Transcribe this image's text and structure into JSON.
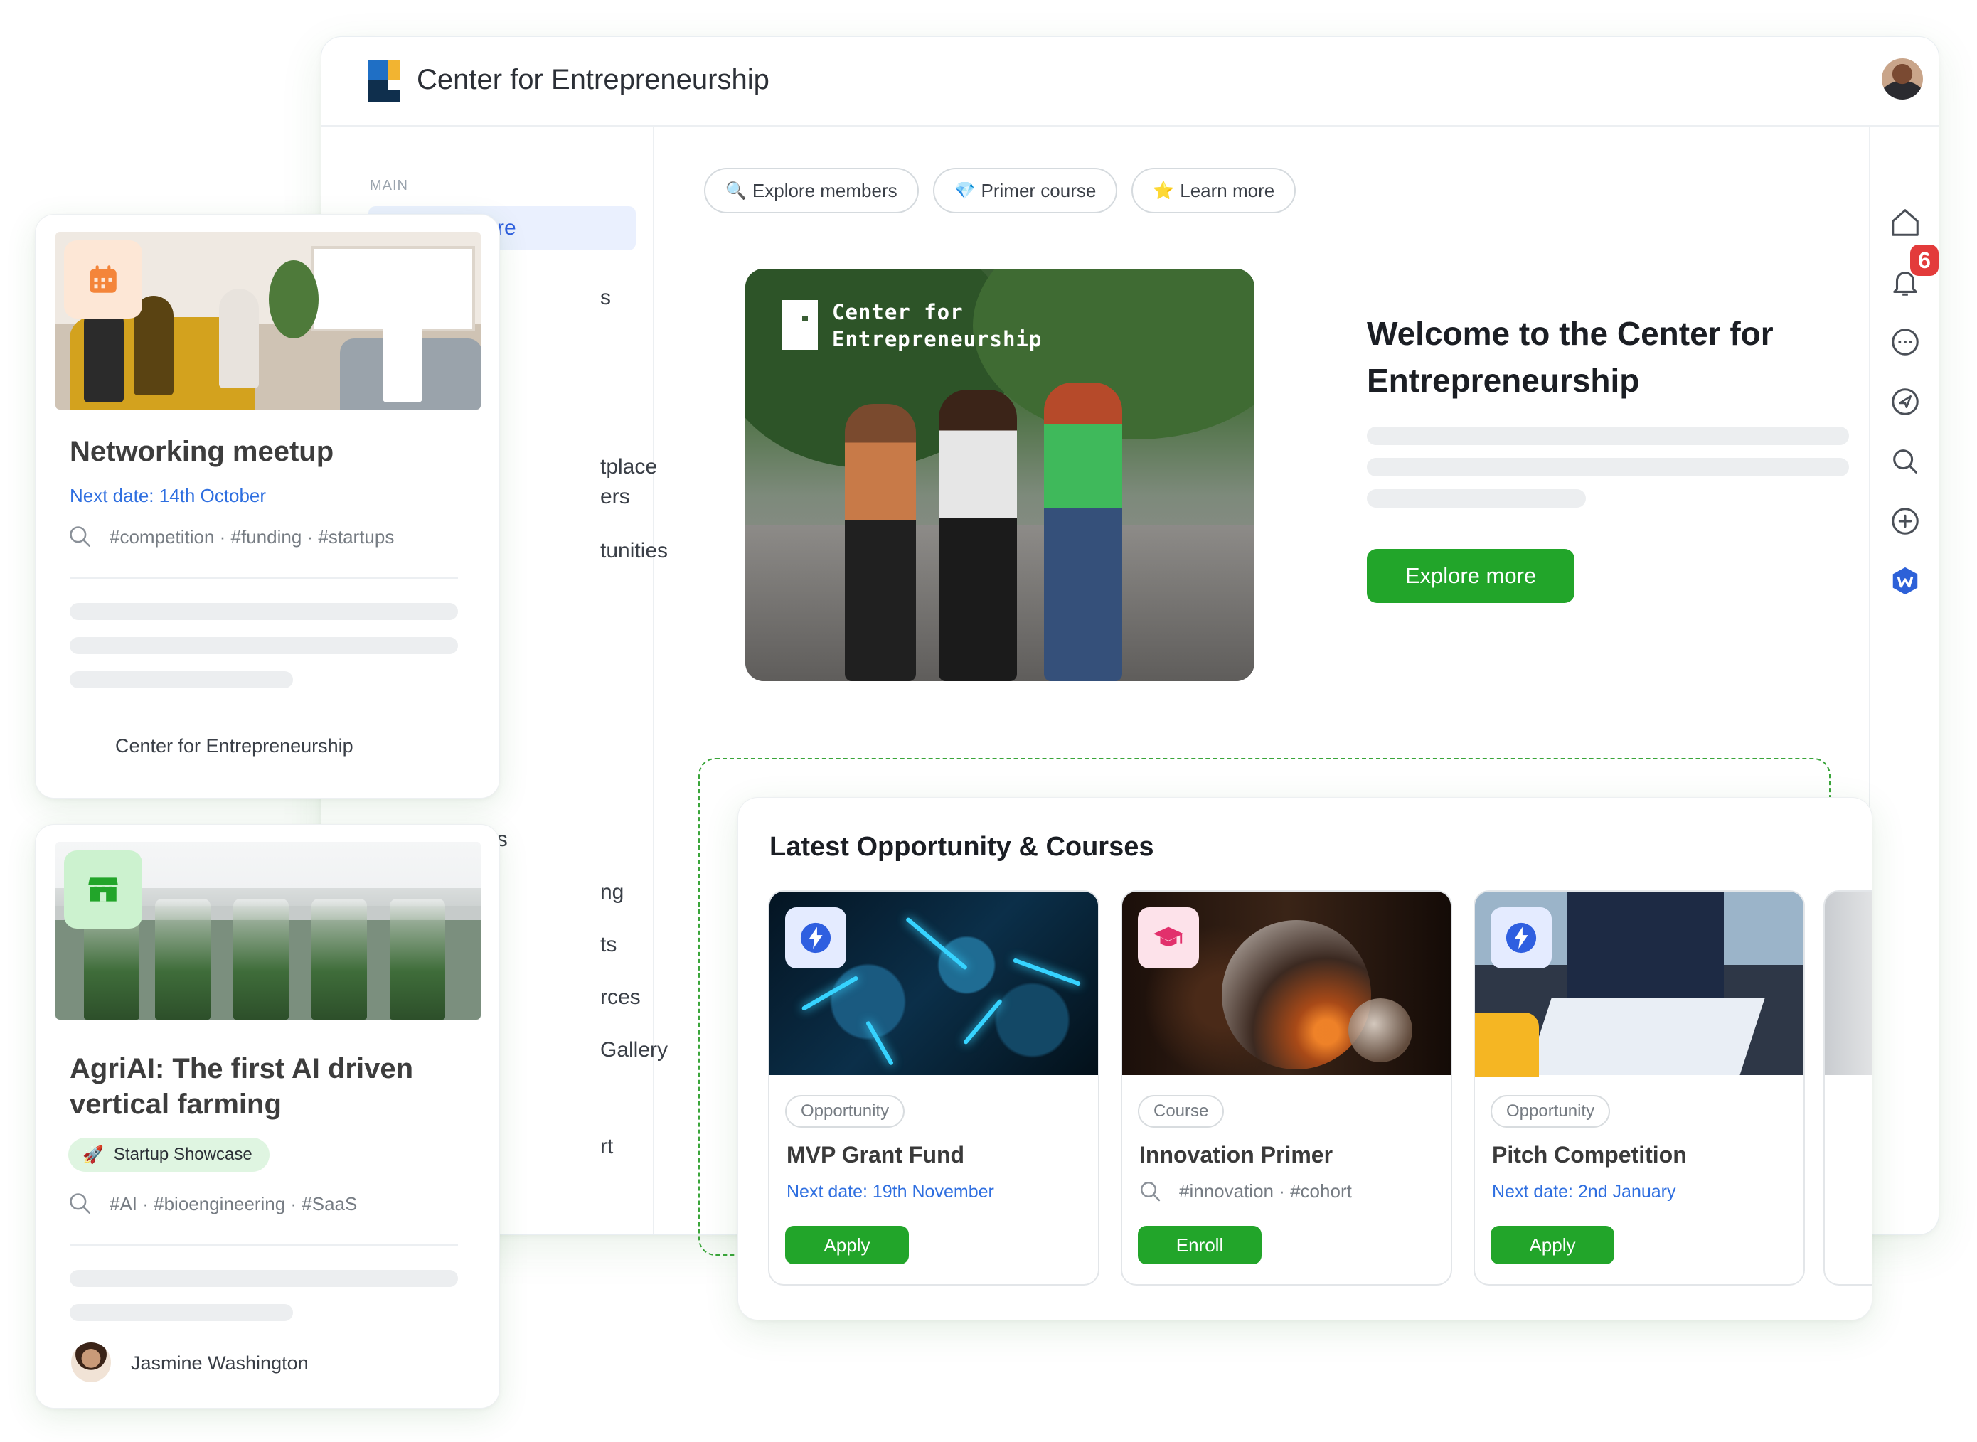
{
  "app": {
    "title": "Center for Entrepreneurship",
    "notification_count": "6"
  },
  "sidebar": {
    "section_label": "MAIN",
    "active_item": "Explore",
    "fragments": [
      "s",
      "tplace",
      "ers",
      "tunities",
      "Events",
      "ng",
      "ts",
      "rces",
      "Gallery",
      "rt"
    ]
  },
  "chips": [
    {
      "icon": "🔍",
      "label": "Explore members"
    },
    {
      "icon": "💎",
      "label": "Primer course"
    },
    {
      "icon": "⭐",
      "label": "Learn more"
    }
  ],
  "hero": {
    "overlay_line1": "Center for",
    "overlay_line2": "Entrepreneurship"
  },
  "welcome": {
    "heading": "Welcome to the Center for Entrepreneurship",
    "button": "Explore more"
  },
  "cards": [
    {
      "title": "Networking meetup",
      "date": "Next date: 14th October",
      "tags": "#competition · #funding · #startups",
      "footer": "Center for Entrepreneurship"
    },
    {
      "title_line1": "AgriAI: The first AI driven",
      "title_line2": "vertical farming",
      "pill_icon": "🚀",
      "pill": "Startup Showcase",
      "tags": "#AI · #bioengineering · #SaaS",
      "footer": "Jasmine Washington"
    }
  ],
  "latest": {
    "title": "Latest Opportunity & Courses",
    "items": [
      {
        "type": "Opportunity",
        "title": "MVP Grant Fund",
        "date": "Next date: 19th November",
        "button": "Apply"
      },
      {
        "type": "Course",
        "title": "Innovation Primer",
        "tags": "#innovation · #cohort",
        "button": "Enroll"
      },
      {
        "type": "Opportunity",
        "title": "Pitch Competition",
        "date": "Next date: 2nd January",
        "button": "Apply"
      }
    ]
  },
  "colors": {
    "brand_green": "#22a52a",
    "link_blue": "#2f6fe0",
    "active_bg": "#eaf0fe",
    "badge_red": "#e33b3b"
  }
}
